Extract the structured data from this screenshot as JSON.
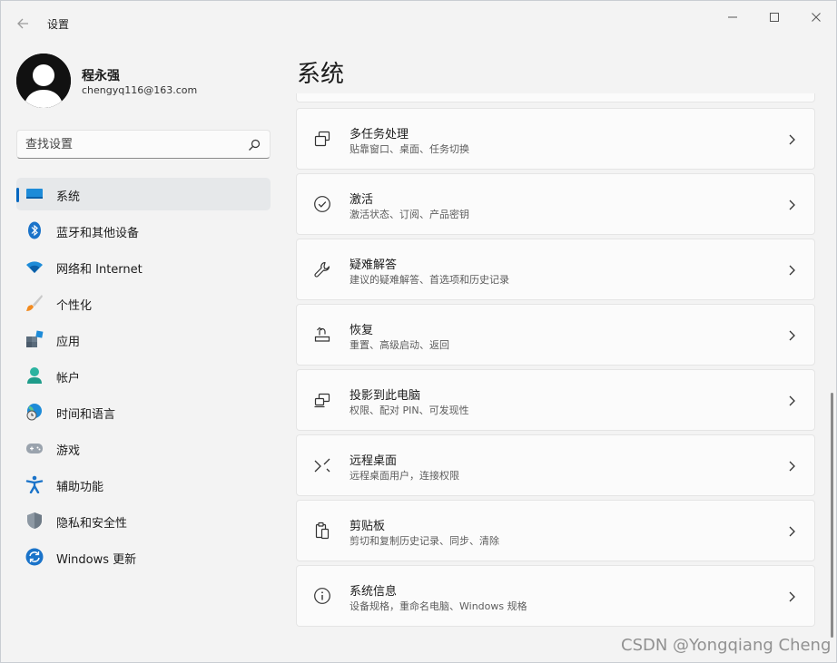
{
  "window": {
    "title": "设置"
  },
  "profile": {
    "name": "程永强",
    "email": "chengyq116@163.com"
  },
  "search": {
    "placeholder": "查找设置"
  },
  "sidebar": {
    "items": [
      {
        "label": "系统",
        "icon": "system-display-icon",
        "active": true
      },
      {
        "label": "蓝牙和其他设备",
        "icon": "bluetooth-icon"
      },
      {
        "label": "网络和 Internet",
        "icon": "wifi-icon"
      },
      {
        "label": "个性化",
        "icon": "paintbrush-icon"
      },
      {
        "label": "应用",
        "icon": "apps-icon"
      },
      {
        "label": "帐户",
        "icon": "account-icon"
      },
      {
        "label": "时间和语言",
        "icon": "globe-clock-icon"
      },
      {
        "label": "游戏",
        "icon": "gamepad-icon"
      },
      {
        "label": "辅助功能",
        "icon": "accessibility-icon"
      },
      {
        "label": "隐私和安全性",
        "icon": "shield-icon"
      },
      {
        "label": "Windows 更新",
        "icon": "update-icon"
      }
    ]
  },
  "main": {
    "title": "系统",
    "cards": [
      {
        "title": "多任务处理",
        "subtitle": "贴靠窗口、桌面、任务切换",
        "icon": "multitasking-icon"
      },
      {
        "title": "激活",
        "subtitle": "激活状态、订阅、产品密钥",
        "icon": "activation-check-icon"
      },
      {
        "title": "疑难解答",
        "subtitle": "建议的疑难解答、首选项和历史记录",
        "icon": "wrench-icon"
      },
      {
        "title": "恢复",
        "subtitle": "重置、高级启动、返回",
        "icon": "recovery-icon"
      },
      {
        "title": "投影到此电脑",
        "subtitle": "权限、配对 PIN、可发现性",
        "icon": "projection-icon"
      },
      {
        "title": "远程桌面",
        "subtitle": "远程桌面用户，连接权限",
        "icon": "remote-desktop-icon"
      },
      {
        "title": "剪贴板",
        "subtitle": "剪切和复制历史记录、同步、清除",
        "icon": "clipboard-icon"
      },
      {
        "title": "系统信息",
        "subtitle": "设备规格，重命名电脑、Windows 规格",
        "icon": "info-icon"
      }
    ]
  },
  "watermark": "CSDN @Yongqiang Cheng",
  "colors": {
    "accent": "#0067c0",
    "background": "#f3f3f3",
    "card": "#fbfbfb"
  }
}
